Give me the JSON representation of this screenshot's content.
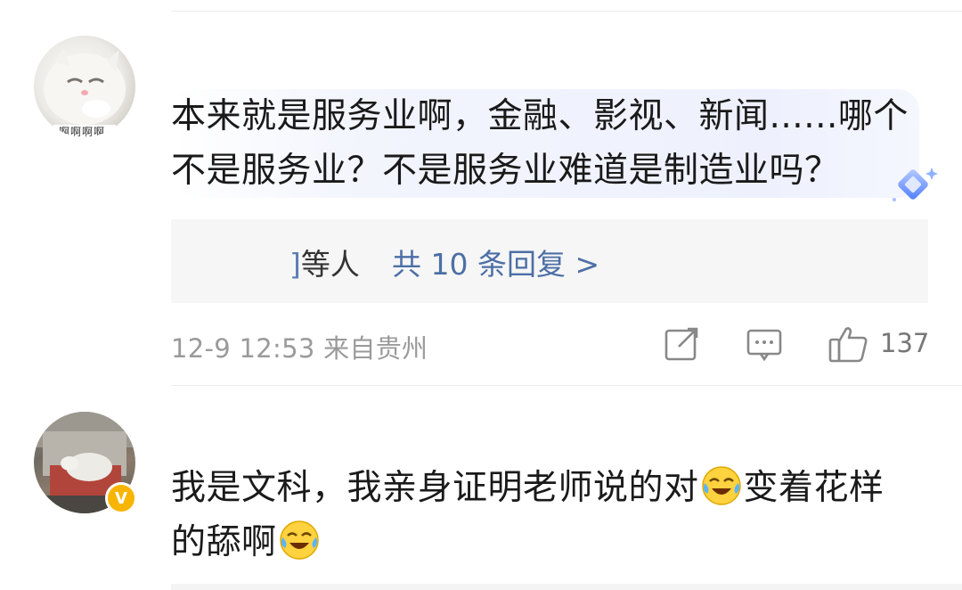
{
  "comments": [
    {
      "text": "本来就是服务业啊，金融、影视、新闻......哪个不是服务业？不是服务业难道是制造业吗？",
      "avatar_caption": "啊啊啊啊",
      "badge_icon": "diamond-icon",
      "replies": {
        "names_mark": "]",
        "names_suffix": "等人",
        "more_label": "共 10 条回复 >"
      },
      "meta": "12-9 12:53 来自贵州",
      "like_count": "137"
    },
    {
      "text_part1": "我是文科，我亲身证明老师说的对",
      "text_part2": "变着花样的舔啊",
      "emoji": "laugh-cry-emoji",
      "verified_badge": "V"
    }
  ],
  "colors": {
    "link_blue": "#4c6fa5",
    "meta_gray": "#9a9a9a",
    "verified_gold": "#f7b500"
  }
}
